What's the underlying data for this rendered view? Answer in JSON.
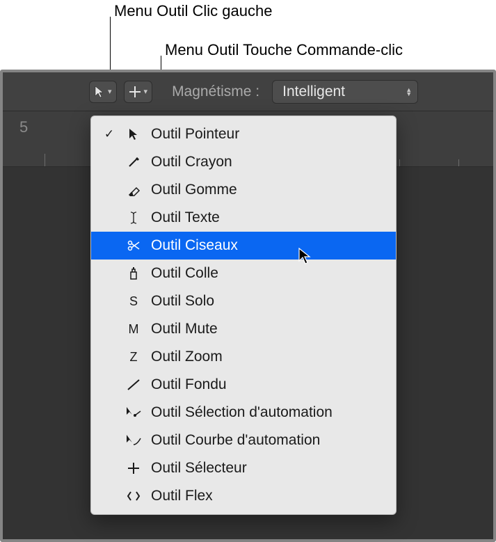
{
  "annotations": {
    "left_click_menu_label": "Menu Outil Clic gauche",
    "cmd_click_menu_label": "Menu Outil Touche Commande-clic"
  },
  "toolbar": {
    "magnetism_label": "Magnétisme :",
    "magnetism_value": "Intelligent"
  },
  "ruler": {
    "number": "5"
  },
  "menu": {
    "highlighted_index": 4,
    "items": [
      {
        "label": "Outil Pointeur",
        "icon": "pointer-icon",
        "checked": true
      },
      {
        "label": "Outil Crayon",
        "icon": "pencil-icon",
        "checked": false
      },
      {
        "label": "Outil Gomme",
        "icon": "eraser-icon",
        "checked": false
      },
      {
        "label": "Outil Texte",
        "icon": "text-cursor-icon",
        "checked": false
      },
      {
        "label": "Outil Ciseaux",
        "icon": "scissors-icon",
        "checked": false
      },
      {
        "label": "Outil Colle",
        "icon": "glue-icon",
        "checked": false
      },
      {
        "label": "Outil Solo",
        "icon": "letter-s-icon",
        "letter": "S",
        "checked": false
      },
      {
        "label": "Outil Mute",
        "icon": "letter-m-icon",
        "letter": "M",
        "checked": false
      },
      {
        "label": "Outil Zoom",
        "icon": "letter-z-icon",
        "letter": "Z",
        "checked": false
      },
      {
        "label": "Outil Fondu",
        "icon": "fade-line-icon",
        "checked": false
      },
      {
        "label": "Outil Sélection d'automation",
        "icon": "automation-select-icon",
        "checked": false
      },
      {
        "label": "Outil Courbe d'automation",
        "icon": "automation-curve-icon",
        "checked": false
      },
      {
        "label": "Outil Sélecteur",
        "icon": "marquee-icon",
        "checked": false
      },
      {
        "label": "Outil Flex",
        "icon": "flex-icon",
        "checked": false
      }
    ]
  }
}
